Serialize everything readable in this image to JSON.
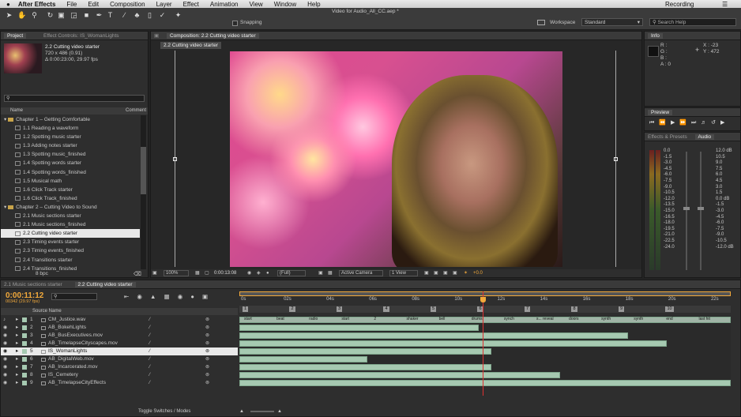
{
  "menubar": {
    "apple": "",
    "app": "After Effects",
    "items": [
      "File",
      "Edit",
      "Composition",
      "Layer",
      "Effect",
      "Animation",
      "View",
      "Window",
      "Help"
    ],
    "recording": "Recording"
  },
  "window_title": "Video for Audio_All_CC.aep *",
  "toolbar": {
    "snapping": "Snapping",
    "workspace_label": "Workspace",
    "workspace_value": "Standard",
    "search_placeholder": "Search Help"
  },
  "project": {
    "tabs": [
      "Project",
      "Effect Controls: IS_WomanLights"
    ],
    "item_name": "2.2 Cutting video starter",
    "item_dims": "720 x 486 (0.91)",
    "item_duration": "Δ 0:00:23:00, 29.97 fps",
    "search_placeholder": "",
    "col_name": "Name",
    "col_comment": "Comment",
    "rows": [
      {
        "type": "folder",
        "label": "Chapter 1 – Getting Comfortable",
        "indent": 0
      },
      {
        "type": "comp",
        "label": "1.1 Reading a waveform",
        "indent": 1
      },
      {
        "type": "comp",
        "label": "1.2 Spotting music starter",
        "indent": 1
      },
      {
        "type": "comp",
        "label": "1.3 Adding notes starter",
        "indent": 1
      },
      {
        "type": "comp",
        "label": "1.3 Spotting music_finished",
        "indent": 1
      },
      {
        "type": "comp",
        "label": "1.4 Spotting words starter",
        "indent": 1
      },
      {
        "type": "comp",
        "label": "1.4 Spotting words_finished",
        "indent": 1
      },
      {
        "type": "comp",
        "label": "1.5 Musical math",
        "indent": 1
      },
      {
        "type": "comp",
        "label": "1.6 Click Track starter",
        "indent": 1
      },
      {
        "type": "comp",
        "label": "1.6 Click Track_finished",
        "indent": 1
      },
      {
        "type": "folder",
        "label": "Chapter 2 – Cutting Video to Sound",
        "indent": 0
      },
      {
        "type": "comp",
        "label": "2.1 Music sections starter",
        "indent": 1
      },
      {
        "type": "comp",
        "label": "2.1 Music sections_finished",
        "indent": 1
      },
      {
        "type": "comp",
        "label": "2.2 Cutting video starter",
        "indent": 1,
        "selected": true
      },
      {
        "type": "comp",
        "label": "2.3 Timing events starter",
        "indent": 1
      },
      {
        "type": "comp",
        "label": "2.3 Timing events_finished",
        "indent": 1
      },
      {
        "type": "comp",
        "label": "2.4 Transitions starter",
        "indent": 1
      },
      {
        "type": "comp",
        "label": "2.4 Transitions_finished",
        "indent": 1
      }
    ],
    "bpc": "8 bpc"
  },
  "composition": {
    "tab": "Composition: 2.2 Cutting video starter",
    "breadcrumb": "2.2 Cutting video starter",
    "zoom": "100%",
    "timecode": "0:00:13:08",
    "resolution": "(Full)",
    "camera": "Active Camera",
    "view": "1 View",
    "exposure": "+0.0"
  },
  "info": {
    "tab": "Info",
    "r": "R :",
    "g": "G :",
    "b": "B :",
    "a": "A : 0",
    "x": "X : -23",
    "y": "Y : 472"
  },
  "preview": {
    "tab": "Preview"
  },
  "effects": {
    "tab": "Effects & Presets",
    "audio_tab": "Audio",
    "left_scale": [
      "0.0",
      "-1.5",
      "-3.0",
      "-4.5",
      "-6.0",
      "-7.5",
      "-9.0",
      "-10.5",
      "-12.0",
      "-13.5",
      "-15.0",
      "-16.5",
      "-18.0",
      "-19.5",
      "-21.0",
      "-22.5",
      "-24.0"
    ],
    "right_scale": [
      "12.0 dB",
      "10.5",
      "9.0",
      "7.5",
      "6.0",
      "4.5",
      "3.0",
      "1.5",
      "0.0 dB",
      "-1.5",
      "-3.0",
      "-4.5",
      "-6.0",
      "-7.5",
      "-9.0",
      "-10.5",
      "-12.0 dB"
    ]
  },
  "timeline": {
    "tabs": [
      "2.1 Music sections starter",
      "2.2 Cutting video starter"
    ],
    "timecode": "0:00:11:12",
    "frames": "00342 (29.97 fps)",
    "search_placeholder": "",
    "col_source": "Source Name",
    "toggle_label": "Toggle Switches / Modes",
    "ruler": [
      "0s",
      "02s",
      "04s",
      "06s",
      "08s",
      "10s",
      "12s",
      "14s",
      "16s",
      "18s",
      "20s",
      "22s"
    ],
    "markers": [
      "1",
      "2",
      "3",
      "4",
      "5",
      "6",
      "7",
      "8",
      "9",
      "10"
    ],
    "audio_markers": [
      "start",
      "beat",
      "radio",
      "start",
      "2",
      "shaker",
      "bell",
      "drums",
      "synch",
      "s... reveal",
      "doors",
      "synth",
      "synth",
      "end",
      "last hit"
    ],
    "layers": [
      {
        "num": "1",
        "name": "CM_Justice.wav",
        "audio": true
      },
      {
        "num": "2",
        "name": "AB_BokehLights"
      },
      {
        "num": "3",
        "name": "AB_BusExecutives.mov"
      },
      {
        "num": "4",
        "name": "AB_TimelapseCityscapes.mov"
      },
      {
        "num": "5",
        "name": "IS_WomanLights",
        "selected": true
      },
      {
        "num": "6",
        "name": "AB_DigitalWeb.mov"
      },
      {
        "num": "7",
        "name": "AB_Incarcerated.mov"
      },
      {
        "num": "8",
        "name": "IS_Cemetery"
      },
      {
        "num": "9",
        "name": "AB_TimelapseCityEffects"
      }
    ],
    "clip_ends": [
      23.0,
      11.2,
      18.2,
      20.0,
      11.8,
      6.0,
      11.8,
      15.0,
      23.0
    ],
    "playhead_seconds": 11.4,
    "duration_seconds": 23.0
  }
}
